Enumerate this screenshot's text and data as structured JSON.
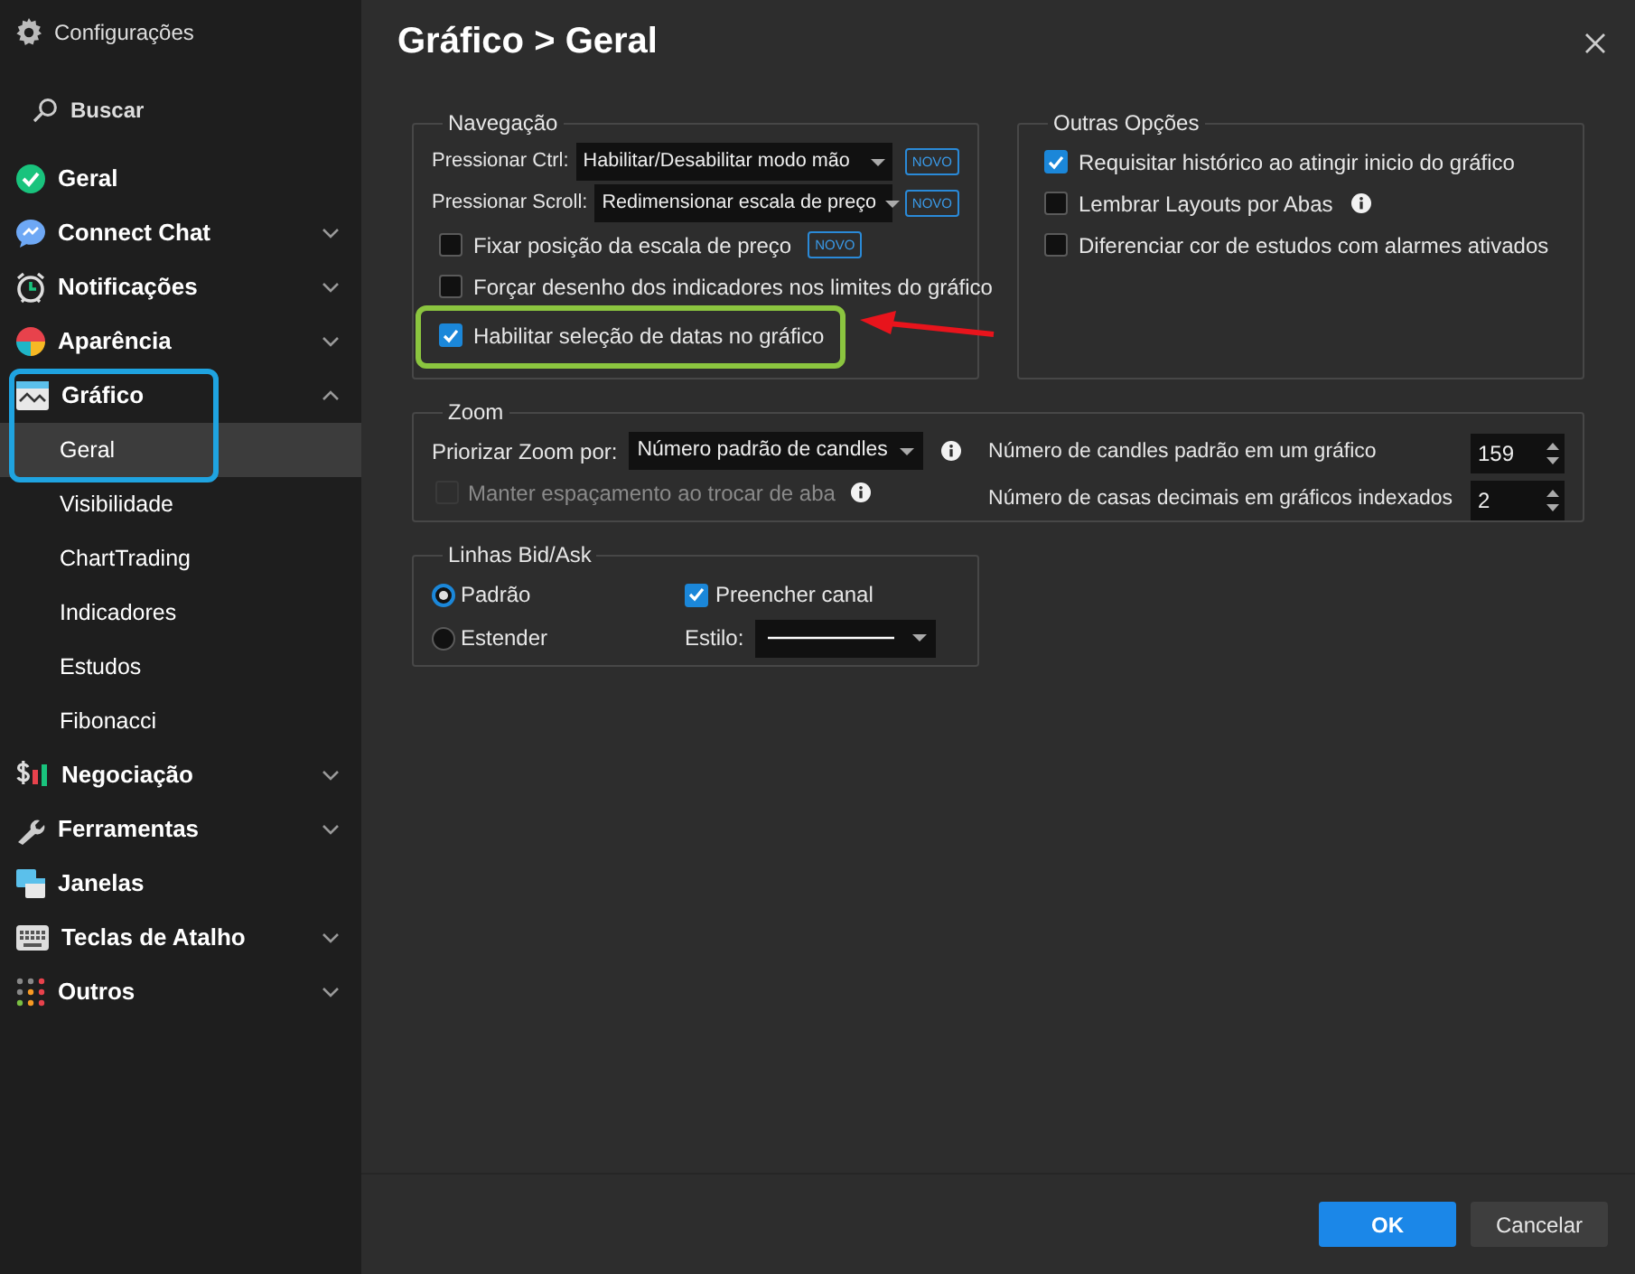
{
  "sidebar": {
    "title": "Configurações",
    "search": {
      "placeholder": "Buscar"
    },
    "items": [
      {
        "label": "Geral",
        "selected": false
      },
      {
        "label": "Connect Chat",
        "expanded": false,
        "selected": false
      },
      {
        "label": "Notificações",
        "expanded": false,
        "selected": false
      },
      {
        "label": "Aparência",
        "expanded": false,
        "selected": false
      },
      {
        "label": "Gráfico",
        "expanded": true,
        "selected": false,
        "highlighted": true,
        "children": [
          {
            "label": "Geral",
            "selected": true
          },
          {
            "label": "Visibilidade",
            "selected": false
          },
          {
            "label": "ChartTrading",
            "selected": false
          },
          {
            "label": "Indicadores",
            "selected": false
          },
          {
            "label": "Estudos",
            "selected": false
          },
          {
            "label": "Fibonacci",
            "selected": false
          }
        ]
      },
      {
        "label": "Negociação",
        "expanded": false,
        "selected": false
      },
      {
        "label": "Ferramentas",
        "expanded": false,
        "selected": false
      },
      {
        "label": "Janelas",
        "selected": false
      },
      {
        "label": "Teclas de Atalho",
        "expanded": false,
        "selected": false
      },
      {
        "label": "Outros",
        "expanded": false,
        "selected": false
      }
    ]
  },
  "page": {
    "title": "Gráfico",
    "separator": ">",
    "subtitle": "Geral"
  },
  "navegacao": {
    "title": "Navegação",
    "rows": [
      {
        "kind": "select",
        "label": "Pressionar Ctrl:",
        "value": "Habilitar/Desabilitar modo mão",
        "badge": "NOVO"
      },
      {
        "kind": "select",
        "label": "Pressionar Scroll:",
        "value": "Redimensionar escala de preço",
        "badge": "NOVO"
      },
      {
        "kind": "checkbox",
        "label": "Fixar posição da escala de preço",
        "checked": false,
        "badge": "NOVO"
      },
      {
        "kind": "checkbox",
        "label": "Forçar desenho dos indicadores nos limites do gráfico",
        "checked": false
      },
      {
        "kind": "checkbox",
        "label": "Habilitar seleção de datas no gráfico",
        "checked": true,
        "highlighted": true
      }
    ]
  },
  "outras": {
    "title": "Outras Opções",
    "rows": [
      {
        "label": "Requisitar histórico ao atingir inicio do gráfico",
        "checked": true
      },
      {
        "label": "Lembrar Layouts por Abas",
        "checked": false,
        "info": true
      },
      {
        "label": "Diferenciar cor de estudos com alarmes ativados",
        "checked": false
      }
    ]
  },
  "zoom": {
    "title": "Zoom",
    "left": [
      {
        "kind": "select",
        "label": "Priorizar Zoom por:",
        "value": "Número padrão de candles",
        "info": true
      },
      {
        "kind": "checkbox",
        "label": "Manter espaçamento ao trocar de aba",
        "checked": false,
        "disabled": true,
        "info": true
      }
    ],
    "right": [
      {
        "label": "Número de candles padrão em um gráfico",
        "value": "159"
      },
      {
        "label": "Número de casas decimais em gráficos indexados",
        "value": "2"
      }
    ]
  },
  "bidask": {
    "title": "Linhas Bid/Ask",
    "radios": [
      {
        "label": "Padrão",
        "selected": true
      },
      {
        "label": "Estender",
        "selected": false
      }
    ],
    "fill": {
      "label": "Preencher canal",
      "checked": true
    },
    "style": {
      "label": "Estilo:"
    }
  },
  "buttons": [
    {
      "label": "OK",
      "primary": true
    },
    {
      "label": "Cancelar",
      "primary": false
    }
  ]
}
